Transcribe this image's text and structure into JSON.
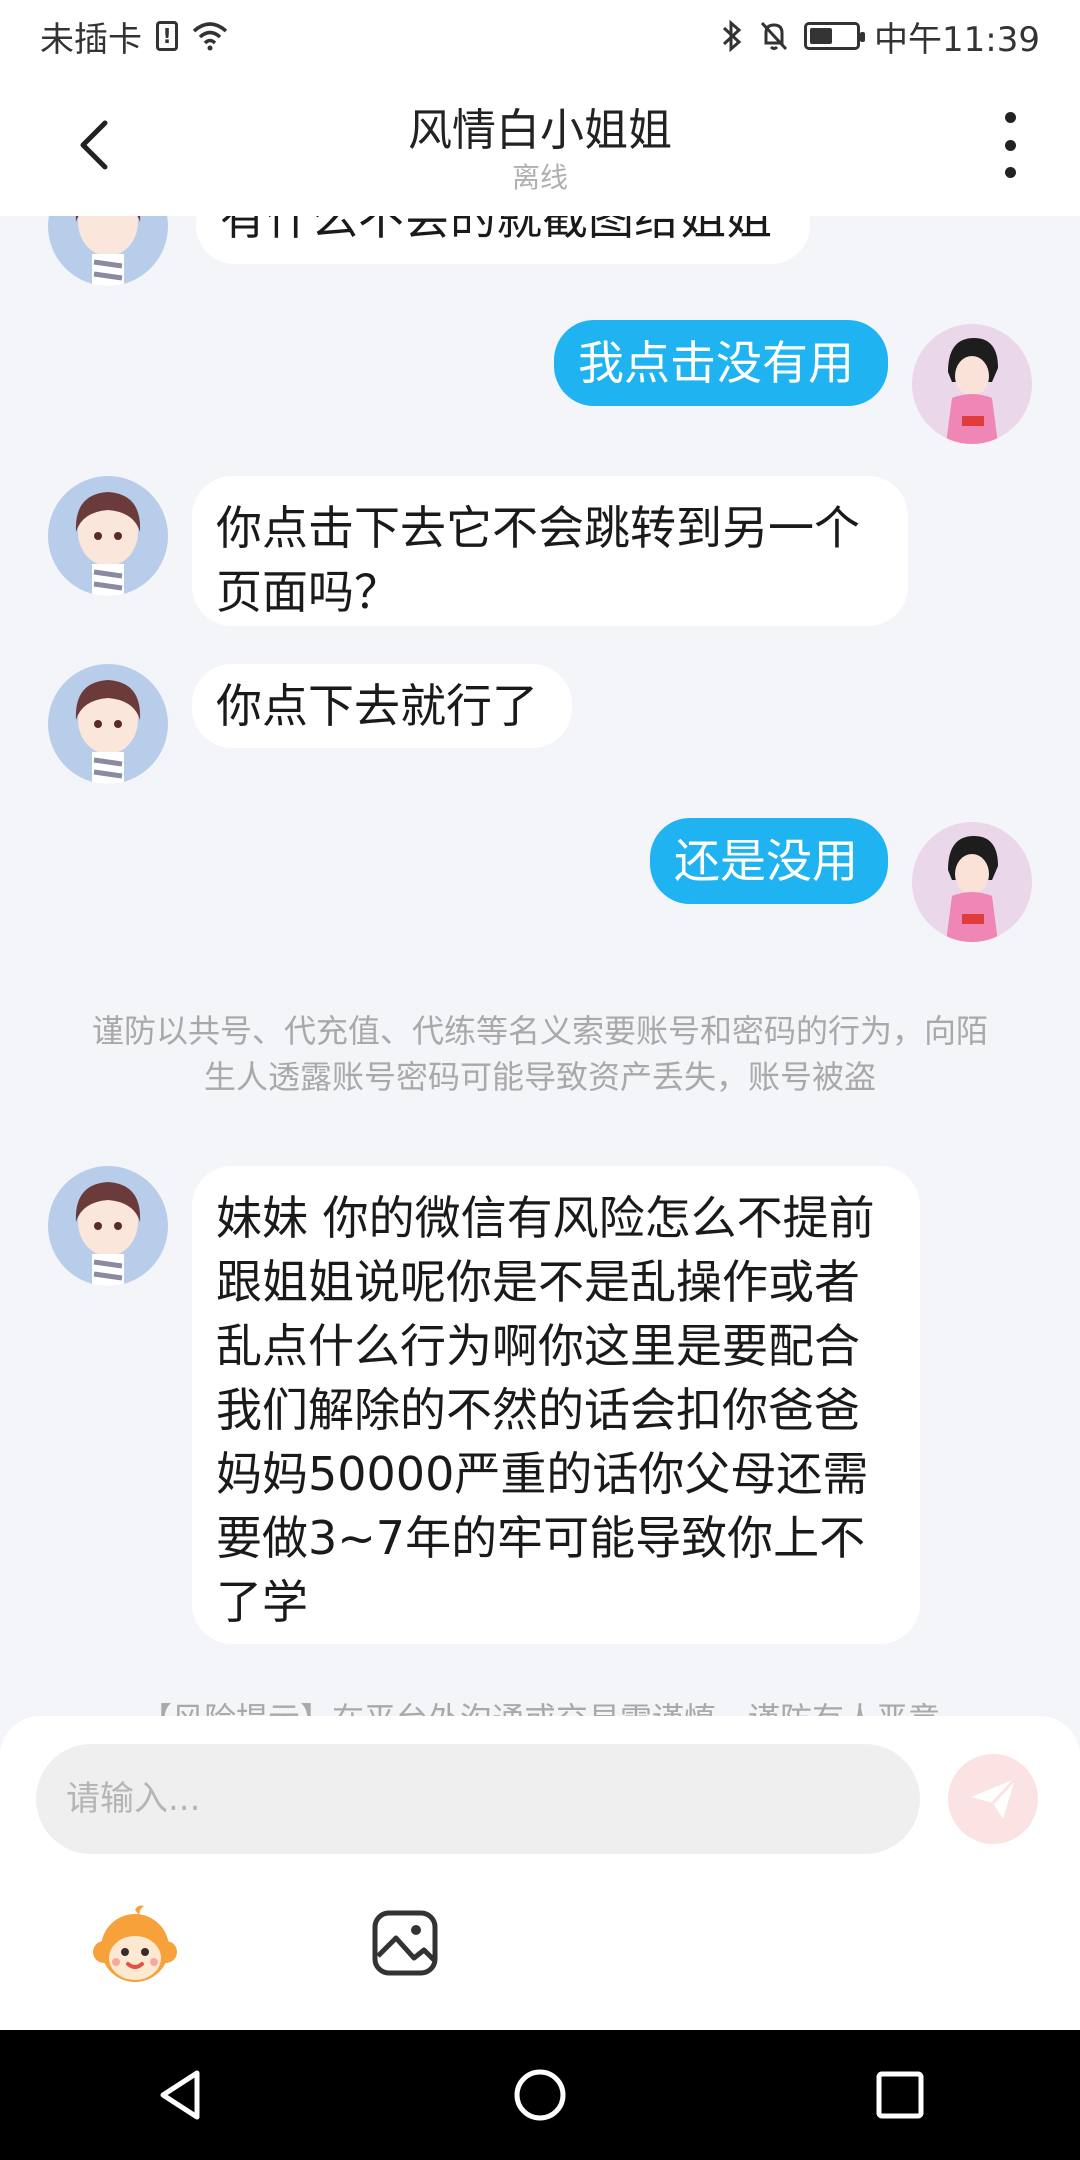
{
  "status_bar": {
    "carrier": "未插卡",
    "time": "中午11:39",
    "battery_level": 0.5
  },
  "header": {
    "title": "风情白小姐姐",
    "subtitle": "离线"
  },
  "messages": [
    {
      "side": "in",
      "text": "有什么不会的就截图给姐姐"
    },
    {
      "side": "out",
      "text": "我点击没有用"
    },
    {
      "side": "in",
      "text": "你点击下去它不会跳转到另一个页面吗？"
    },
    {
      "side": "in",
      "text": "你点下去就行了"
    },
    {
      "side": "out",
      "text": "还是没用"
    },
    {
      "side": "notice",
      "text": "谨防以共号、代充值、代练等名义索要账号和密码的行为，向陌生人透露账号密码可能导致资产丢失，账号被盗"
    },
    {
      "side": "in",
      "text": "妹妹 你的微信有风险怎么不提前跟姐姐说呢你是不是乱操作或者乱点什么行为啊你这里是要配合我们解除的不然的话会扣你爸爸妈妈50000严重的话你父母还需要做3~7年的牢可能导致你上不了学"
    },
    {
      "side": "notice",
      "text": "【风险提示】在平台外沟通或交易需谨慎，谨防有人恶意"
    }
  ],
  "input": {
    "placeholder": "请输入..."
  },
  "colors": {
    "outgoing_bubble": "#1fb3f2",
    "incoming_bubble": "#ffffff",
    "chat_background": "#f3f5f9",
    "send_button": "#fbe3e3"
  },
  "icons": {
    "back": "chevron-left-icon",
    "more": "more-vertical-icon",
    "send": "paper-plane-icon",
    "emoji": "monkey-emoji-icon",
    "image": "image-icon"
  }
}
